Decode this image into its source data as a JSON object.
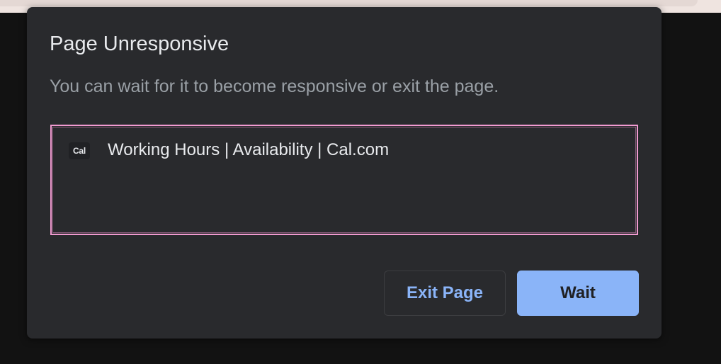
{
  "dialog": {
    "title": "Page Unresponsive",
    "message": "You can wait for it to become responsive or exit the page.",
    "pages": [
      {
        "favicon_text": "Cal",
        "title": "Working Hours | Availability | Cal.com"
      }
    ],
    "buttons": {
      "exit_label": "Exit Page",
      "wait_label": "Wait"
    }
  },
  "colors": {
    "dialog_background": "#292a2d",
    "accent": "#8ab4f8",
    "focus_ring": "#f19ad0",
    "primary_text": "#e8eaed",
    "secondary_text": "#9aa0a6"
  }
}
